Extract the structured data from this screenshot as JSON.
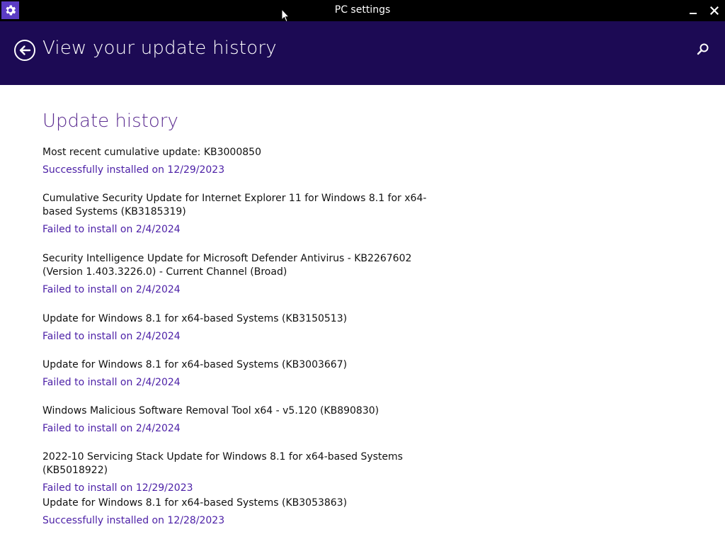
{
  "window": {
    "title": "PC settings",
    "icon": "gear-icon",
    "minimize_icon": "minimize-icon",
    "close_icon": "close-icon"
  },
  "header": {
    "title": "View your update history",
    "back_icon": "back-arrow-icon",
    "search_icon": "search-icon",
    "background": "#1c0a54"
  },
  "content": {
    "heading": "Update history",
    "accent": "#5c2d91",
    "status_color": "#4b1fa6",
    "updates": [
      {
        "name": "Most recent cumulative update: KB3000850",
        "status": "Successfully installed on 12/29/2023"
      },
      {
        "name": "Cumulative Security Update for Internet Explorer 11 for Windows 8.1 for x64-based Systems (KB3185319)",
        "status": "Failed to install on 2/4/2024"
      },
      {
        "name": "Security Intelligence Update for Microsoft Defender Antivirus - KB2267602 (Version 1.403.3226.0) - Current Channel (Broad)",
        "status": "Failed to install on 2/4/2024"
      },
      {
        "name": "Update for Windows 8.1 for x64-based Systems (KB3150513)",
        "status": "Failed to install on 2/4/2024"
      },
      {
        "name": "Update for Windows 8.1 for x64-based Systems (KB3003667)",
        "status": "Failed to install on 2/4/2024"
      },
      {
        "name": "Windows Malicious Software Removal Tool x64 - v5.120 (KB890830)",
        "status": "Failed to install on 2/4/2024"
      },
      {
        "name": "2022-10 Servicing Stack Update for Windows 8.1 for x64-based Systems (KB5018922)",
        "status": "Failed to install on 12/29/2023"
      },
      {
        "name": "Update for Windows 8.1 for x64-based Systems (KB3053863)",
        "status": "Successfully installed on 12/28/2023"
      }
    ]
  }
}
